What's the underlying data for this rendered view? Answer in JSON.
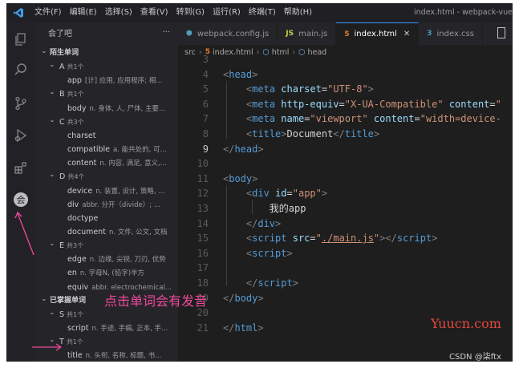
{
  "titlebar": {
    "menu": [
      "文件(F)",
      "编辑(E)",
      "选择(S)",
      "查看(V)",
      "转到(G)",
      "运行(R)",
      "终端(T)",
      "帮助(H)"
    ],
    "window_title": "index.html - webpack-vue"
  },
  "activity_icons": [
    "files-icon",
    "search-icon",
    "source-control-icon",
    "run-debug-icon",
    "extensions-icon",
    "word-plugin-icon"
  ],
  "sidebar": {
    "title": "会了吧",
    "more": "···",
    "unfamiliar": {
      "title": "陌生单词",
      "groups": [
        {
          "letter": "A",
          "count": "共1个",
          "words": [
            {
              "word": "app",
              "def": "[计] 应用, 应用程序; 相..."
            }
          ]
        },
        {
          "letter": "B",
          "count": "共1个",
          "words": [
            {
              "word": "body",
              "def": "n. 身体, 人, 尸体, 主要..."
            }
          ]
        },
        {
          "letter": "C",
          "count": "共3个",
          "words": [
            {
              "word": "charset",
              "def": ""
            },
            {
              "word": "compatible",
              "def": "a. 能共处的, 可..."
            },
            {
              "word": "content",
              "def": "n. 内容, 满足, 意义,..."
            }
          ]
        },
        {
          "letter": "D",
          "count": "共4个",
          "words": [
            {
              "word": "device",
              "def": "n. 装置, 设计, 策略, ..."
            },
            {
              "word": "div",
              "def": "abbr. 分开（divide）; ..."
            },
            {
              "word": "doctype",
              "def": ""
            },
            {
              "word": "document",
              "def": "n. 文件, 公文, 文档"
            }
          ]
        },
        {
          "letter": "E",
          "count": "共3个",
          "words": [
            {
              "word": "edge",
              "def": "n. 边缘, 尖锐, 刀刃, 优势"
            },
            {
              "word": "en",
              "def": "n. 字母N, (铅字)半方"
            },
            {
              "word": "equiv",
              "def": "abbr. electrochemical..."
            }
          ]
        }
      ]
    },
    "mastered": {
      "title": "已掌握单词",
      "groups": [
        {
          "letter": "S",
          "count": "共1个",
          "words": [
            {
              "word": "script",
              "def": "n. 手迹, 手稿, 正本, 手..."
            }
          ]
        },
        {
          "letter": "T",
          "count": "共1个",
          "words": [
            {
              "word": "title",
              "def": "n. 头衔, 名称, 标题, 书..."
            }
          ]
        }
      ]
    }
  },
  "tabs": [
    {
      "label": "webpack.config.js",
      "icon": "⬢",
      "color": "#519aba",
      "active": false
    },
    {
      "label": "main.js",
      "icon": "JS",
      "color": "#cbcb41",
      "active": false
    },
    {
      "label": "index.html",
      "icon": "5",
      "color": "#e37933",
      "active": true,
      "close": "✕"
    },
    {
      "label": "index.css",
      "icon": "3",
      "color": "#519aba",
      "active": false
    }
  ],
  "breadcrumb": [
    "src",
    "index.html",
    "html",
    "head"
  ],
  "editor": {
    "current_line": 9,
    "lines": [
      {
        "n": "3",
        "html": ""
      },
      {
        "n": "4",
        "html": "<span class=\"t\">&lt;</span><span class=\"tg\">head</span><span class=\"t\">&gt;</span>"
      },
      {
        "n": "5",
        "html": "    <span class=\"t\">&lt;</span><span class=\"tg\">meta</span> <span class=\"at\">charset</span><span class=\"tx\">=</span><span class=\"st\">\"UTF-8\"</span><span class=\"t\">&gt;</span>"
      },
      {
        "n": "6",
        "html": "    <span class=\"t\">&lt;</span><span class=\"tg\">meta</span> <span class=\"at\">http-equiv</span><span class=\"tx\">=</span><span class=\"st\">\"X-UA-Compatible\"</span> <span class=\"at\">content</span><span class=\"tx\">=</span><span class=\"st\">\"</span>"
      },
      {
        "n": "7",
        "html": "    <span class=\"t\">&lt;</span><span class=\"tg\">meta</span> <span class=\"at\">name</span><span class=\"tx\">=</span><span class=\"st\">\"viewport\"</span> <span class=\"at\">content</span><span class=\"tx\">=</span><span class=\"st\">\"width=device-</span>"
      },
      {
        "n": "8",
        "html": "    <span class=\"t\">&lt;</span><span class=\"tg\">title</span><span class=\"t\">&gt;</span><span class=\"tx\">Document</span><span class=\"t\">&lt;/</span><span class=\"tg\">title</span><span class=\"t\">&gt;</span>"
      },
      {
        "n": "9",
        "html": "<span class=\"t\">&lt;/</span><span class=\"tg\">head</span><span class=\"t\">&gt;</span>"
      },
      {
        "n": "10",
        "html": ""
      },
      {
        "n": "11",
        "html": "<span class=\"t\">&lt;</span><span class=\"tg\">body</span><span class=\"t\">&gt;</span>"
      },
      {
        "n": "12",
        "html": "    <span class=\"t\">&lt;</span><span class=\"tg\">div</span> <span class=\"at\">id</span><span class=\"tx\">=</span><span class=\"st\">\"app\"</span><span class=\"t\">&gt;</span>"
      },
      {
        "n": "13",
        "html": "        <span class=\"tx\">我的app</span>"
      },
      {
        "n": "14",
        "html": "    <span class=\"t\">&lt;/</span><span class=\"tg\">div</span><span class=\"t\">&gt;</span>"
      },
      {
        "n": "15",
        "html": "    <span class=\"t\">&lt;</span><span class=\"tg\">script</span> <span class=\"at\">src</span><span class=\"tx\">=</span><span class=\"st\">\"<span class=\"ul\">./main.js</span>\"</span><span class=\"t\">&gt;&lt;/</span><span class=\"tg\">script</span><span class=\"t\">&gt;</span>"
      },
      {
        "n": "16",
        "html": "    <span class=\"t\">&lt;</span><span class=\"tg\">script</span><span class=\"t\">&gt;</span>"
      },
      {
        "n": "17",
        "html": ""
      },
      {
        "n": "18",
        "html": "    <span class=\"t\">&lt;/</span><span class=\"tg\">script</span><span class=\"t\">&gt;</span>"
      },
      {
        "n": "19",
        "html": "<span class=\"t\">&lt;/</span><span class=\"tg\">body</span><span class=\"t\">&gt;</span>"
      },
      {
        "n": "20",
        "html": ""
      },
      {
        "n": "21",
        "html": "<span class=\"t\">&lt;/</span><span class=\"tg\">html</span><span class=\"t\">&gt;</span>"
      }
    ]
  },
  "annotation": "点击单词会有发音",
  "watermark": "Yuucn.com",
  "credit": "CSDN @柒ftx",
  "colors": {
    "accent": "#3794ff",
    "annotation": "#f0489a",
    "watermark": "#e4483c"
  }
}
